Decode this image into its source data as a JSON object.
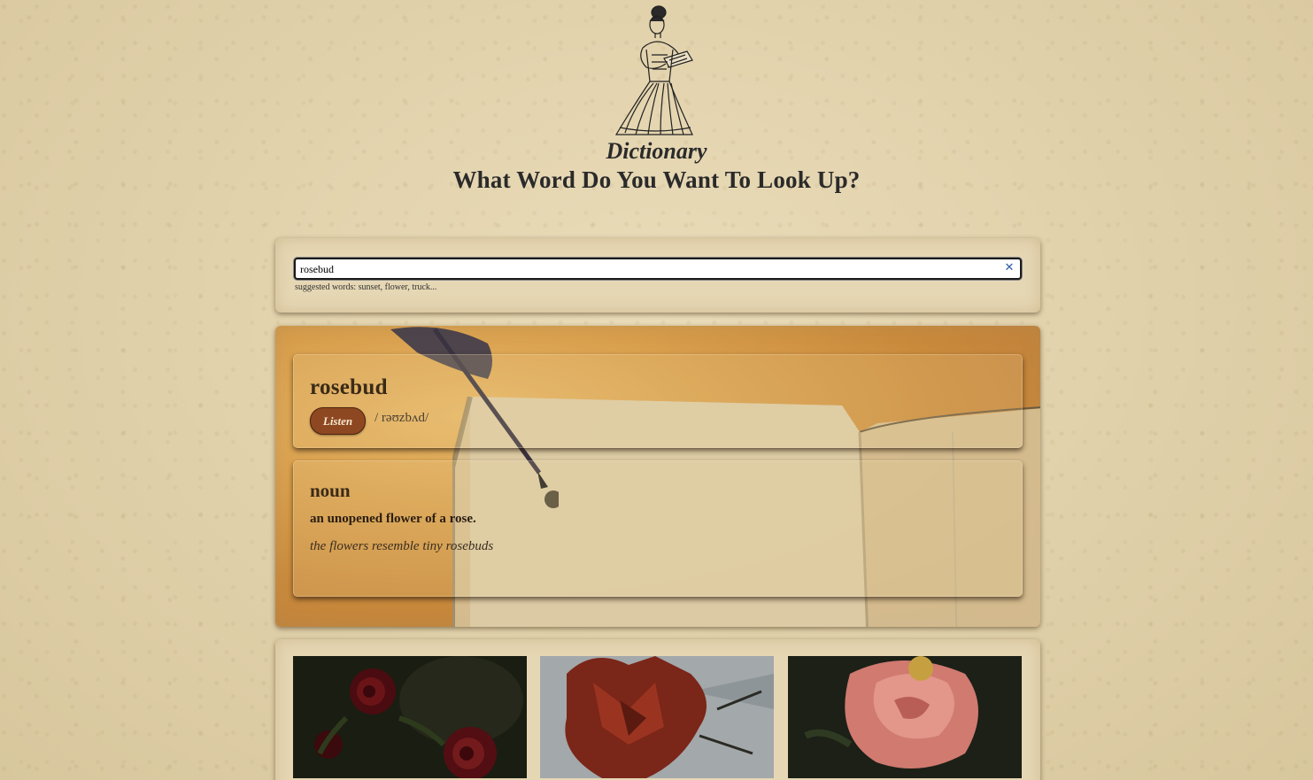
{
  "header": {
    "title": "Dictionary",
    "subtitle": "What Word Do You Want To Look Up?",
    "logo_icon": "reading-lady-illustration"
  },
  "search": {
    "value": "rosebud",
    "clear_icon": "close-icon",
    "hint": "suggested words: sunset, flower, truck..."
  },
  "result": {
    "word": "rosebud",
    "listen_label": "Listen",
    "phonetic": "/ rəʊzbʌd/",
    "meanings": [
      {
        "part_of_speech": "noun",
        "definition": "an unopened flower of a rose.",
        "example": "the flowers resemble tiny rosebuds"
      }
    ]
  },
  "images": [
    {
      "subject": "dark red rose",
      "colors": [
        "#1c1a12",
        "#5a0f12"
      ]
    },
    {
      "subject": "red rose from below",
      "colors": [
        "#9aa0a4",
        "#7a2a1c"
      ]
    },
    {
      "subject": "pink rose",
      "colors": [
        "#1b1f16",
        "#d98078"
      ]
    }
  ],
  "colors": {
    "paper": "#e3d4b0",
    "listen_button": "#8e4821",
    "clear_icon": "#2d5aa8"
  }
}
